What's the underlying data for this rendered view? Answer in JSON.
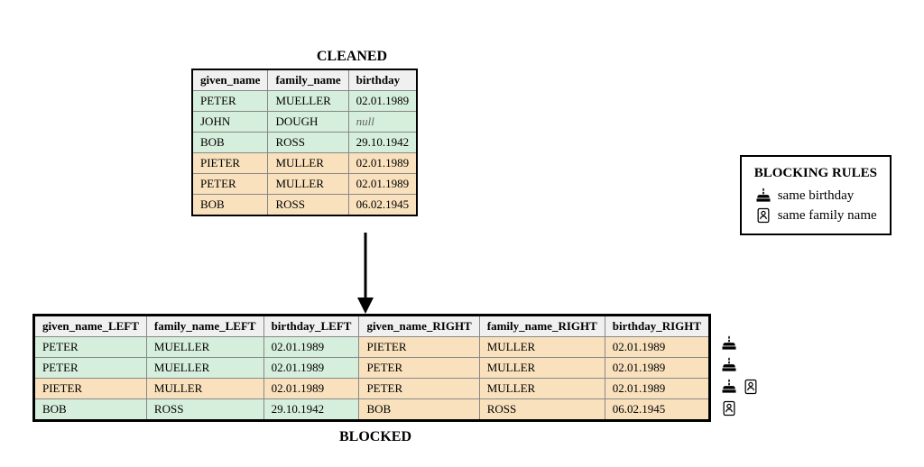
{
  "titles": {
    "cleaned": "CLEANED",
    "blocked": "BLOCKED"
  },
  "cleaned_table": {
    "headers": [
      "given_name",
      "family_name",
      "birthday"
    ],
    "rows": [
      {
        "cells": [
          "PETER",
          "MUELLER",
          "02.01.1989"
        ],
        "color": "green"
      },
      {
        "cells": [
          "JOHN",
          "DOUGH",
          "null"
        ],
        "color": "green",
        "null_col": 2
      },
      {
        "cells": [
          "BOB",
          "ROSS",
          "29.10.1942"
        ],
        "color": "green"
      },
      {
        "cells": [
          "PIETER",
          "MULLER",
          "02.01.1989"
        ],
        "color": "orange"
      },
      {
        "cells": [
          "PETER",
          "MULLER",
          "02.01.1989"
        ],
        "color": "orange"
      },
      {
        "cells": [
          "BOB",
          "ROSS",
          "06.02.1945"
        ],
        "color": "orange"
      }
    ]
  },
  "blocked_table": {
    "headers": [
      "given_name_LEFT",
      "family_name_LEFT",
      "birthday_LEFT",
      "given_name_RIGHT",
      "family_name_RIGHT",
      "birthday_RIGHT"
    ],
    "rows": [
      {
        "left_color": "green",
        "right_color": "orange",
        "cells": [
          "PETER",
          "MUELLER",
          "02.01.1989",
          "PIETER",
          "MULLER",
          "02.01.1989"
        ],
        "icons": [
          "birthday"
        ]
      },
      {
        "left_color": "green",
        "right_color": "orange",
        "cells": [
          "PETER",
          "MUELLER",
          "02.01.1989",
          "PETER",
          "MULLER",
          "02.01.1989"
        ],
        "icons": [
          "birthday"
        ]
      },
      {
        "left_color": "orange",
        "right_color": "orange",
        "cells": [
          "PIETER",
          "MULLER",
          "02.01.1989",
          "PETER",
          "MULLER",
          "02.01.1989"
        ],
        "icons": [
          "birthday",
          "family"
        ]
      },
      {
        "left_color": "green",
        "right_color": "orange",
        "cells": [
          "BOB",
          "ROSS",
          "29.10.1942",
          "BOB",
          "ROSS",
          "06.02.1945"
        ],
        "icons": [
          "family"
        ]
      }
    ]
  },
  "rules": {
    "title": "BLOCKING RULES",
    "items": [
      {
        "icon": "birthday",
        "label": "same birthday"
      },
      {
        "icon": "family",
        "label": "same family name"
      }
    ]
  }
}
